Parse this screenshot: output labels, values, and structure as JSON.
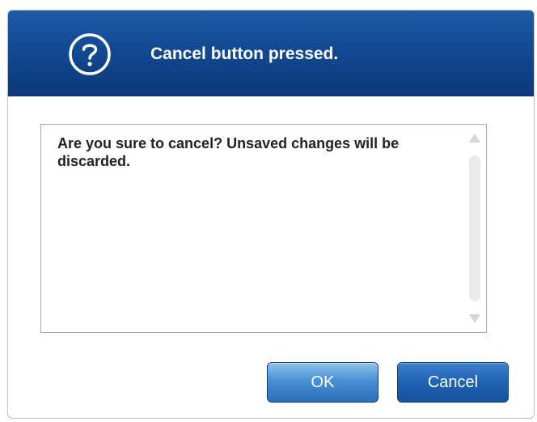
{
  "dialog": {
    "title": "Cancel button pressed.",
    "icon": "question-circle-icon",
    "message": "Are you sure to cancel? Unsaved changes will be discarded.",
    "buttons": {
      "ok_label": "OK",
      "cancel_label": "Cancel"
    }
  },
  "colors": {
    "title_bar": "#124a92",
    "button_ok": "#4a90d4",
    "button_cancel": "#1f62b3"
  }
}
